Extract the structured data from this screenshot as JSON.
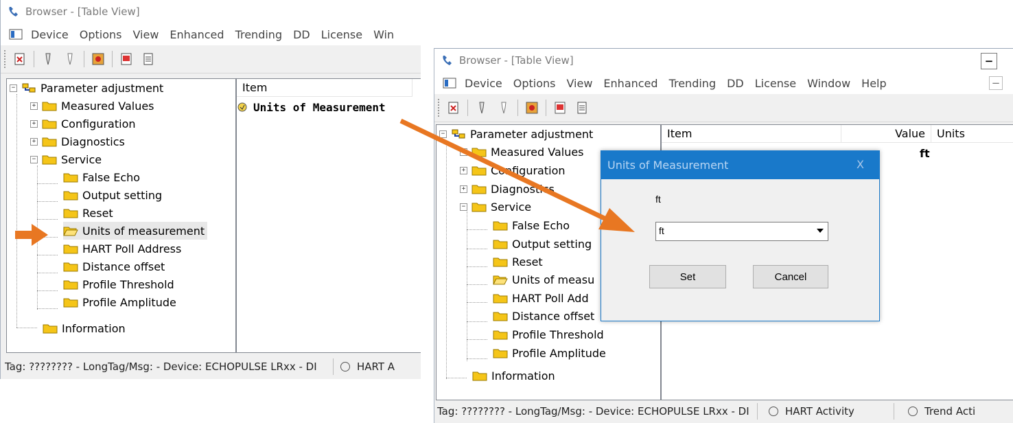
{
  "window_left": {
    "title": "Browser - [Table View]",
    "menu": [
      "Device",
      "Options",
      "View",
      "Enhanced",
      "Trending",
      "DD",
      "License",
      "Win"
    ],
    "tree": {
      "root": "Parameter adjustment",
      "children": [
        "Measured Values",
        "Configuration",
        "Diagnostics",
        "Service"
      ],
      "service_children": [
        "False Echo",
        "Output setting",
        "Reset",
        "Units of measurement",
        "HART Poll Address",
        "Distance offset",
        "Profile Threshold",
        "Profile Amplitude"
      ],
      "information": "Information"
    },
    "list": {
      "col_item": "Item",
      "row_item": "Units of Measurement"
    },
    "status": {
      "tag": "Tag: ???????? - LongTag/Msg:  - Device: ECHOPULSE LRxx - DI",
      "hart": "HART A"
    }
  },
  "window_right": {
    "title": "Browser - [Table View]",
    "menu": [
      "Device",
      "Options",
      "View",
      "Enhanced",
      "Trending",
      "DD",
      "License",
      "Window",
      "Help"
    ],
    "tree": {
      "root": "Parameter adjustment",
      "children": [
        "Measured Values",
        "Configuration",
        "Diagnostics",
        "Service"
      ],
      "service_children": [
        "False Echo",
        "Output setting",
        "Reset",
        "Units of measu",
        "HART Poll Add",
        "Distance offset",
        "Profile Threshold",
        "Profile Amplitude"
      ],
      "information": "Information"
    },
    "list": {
      "col_item": "Item",
      "col_value": "Value",
      "col_units": "Units",
      "row_value": "ft"
    },
    "status": {
      "tag": "Tag: ???????? - LongTag/Msg:  - Device: ECHOPULSE LRxx - DI",
      "hart": "HART Activity",
      "trend": "Trend Acti"
    }
  },
  "dialog": {
    "title": "Units of Measurement",
    "close": "X",
    "current_value": "ft",
    "select_value": "ft",
    "set_label": "Set",
    "cancel_label": "Cancel"
  },
  "colors": {
    "accent_arrow": "#e87722",
    "dialog_title_bg": "#1979ca",
    "folder": "#f5c518"
  }
}
